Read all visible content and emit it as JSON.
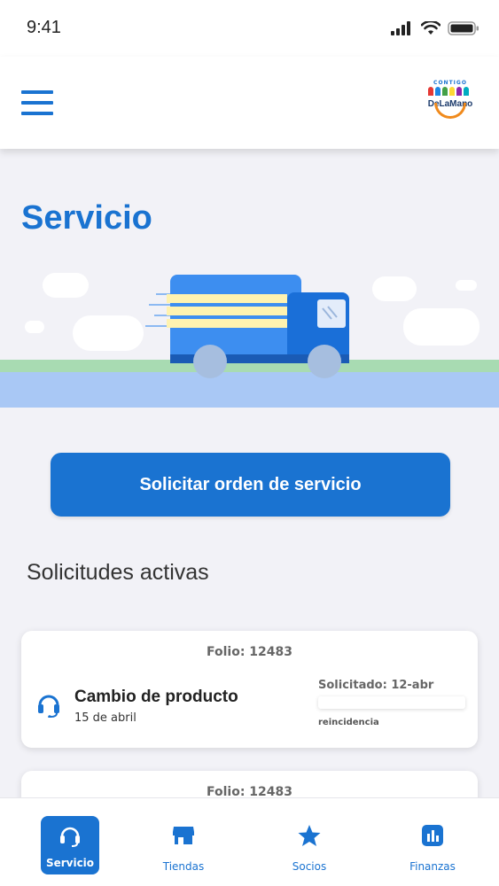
{
  "status_bar": {
    "time": "9:41"
  },
  "header": {
    "logo_top": "CONTIGO",
    "logo_text": "DeLaMano"
  },
  "page": {
    "title": "Servicio"
  },
  "actions": {
    "request_button": "Solicitar orden de servicio"
  },
  "section": {
    "title": "Solicitudes activas"
  },
  "cards": [
    {
      "folio": "Folio: 12483",
      "name": "Cambio de producto",
      "date": "15 de abril",
      "requested": "Solicitado: 12-abr",
      "status": "reincidencia"
    },
    {
      "folio": "Folio: 12483"
    }
  ],
  "bottom_nav": [
    {
      "label": "Servicio",
      "icon": "headset-icon",
      "active": true
    },
    {
      "label": "Tiendas",
      "icon": "store-icon",
      "active": false
    },
    {
      "label": "Socios",
      "icon": "star-icon",
      "active": false
    },
    {
      "label": "Finanzas",
      "icon": "chart-icon",
      "active": false
    }
  ],
  "colors": {
    "primary": "#1a73d1",
    "background": "#f2f2f7",
    "road": "#a9c8f5",
    "grass": "#a8dbb2",
    "logo_orange": "#f08a1c"
  }
}
